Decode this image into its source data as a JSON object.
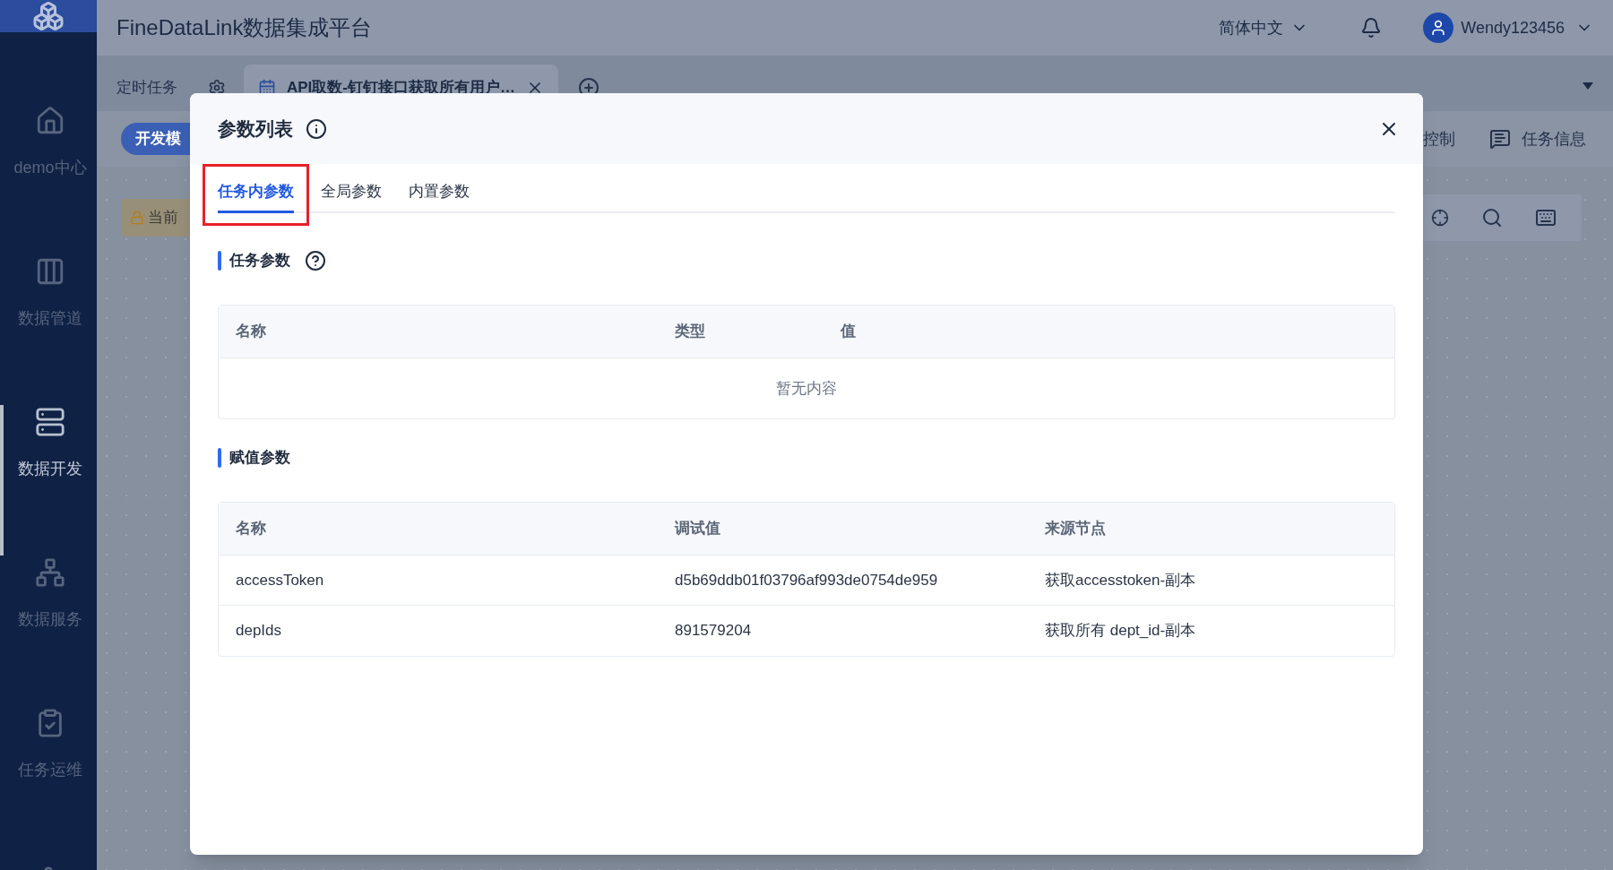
{
  "app": {
    "title": "FineDataLink数据集成平台",
    "language": "简体中文",
    "user": "Wendy123456"
  },
  "sidebar": {
    "items": [
      {
        "label": "demo中心",
        "selected": false
      },
      {
        "label": "数据管道",
        "selected": false
      },
      {
        "label": "数据开发",
        "selected": true
      },
      {
        "label": "数据服务",
        "selected": false
      },
      {
        "label": "任务运维",
        "selected": false
      }
    ]
  },
  "task_folder": {
    "label": "定时任务"
  },
  "open_tabs": [
    {
      "label": "API取数-钉钉接口获取所有用户…",
      "selected": true
    }
  ],
  "toolbar": {
    "mode_button": "开发模",
    "notice": "当前",
    "items": [
      "控制",
      "任务信息"
    ]
  },
  "dialog": {
    "title": "参数列表",
    "tabs": [
      {
        "label": "任务内参数",
        "selected": true,
        "highlighted": true
      },
      {
        "label": "全局参数",
        "selected": false,
        "highlighted": false
      },
      {
        "label": "内置参数",
        "selected": false,
        "highlighted": false
      }
    ],
    "sections": [
      {
        "title": "任务参数",
        "help": true,
        "columns": [
          "名称",
          "类型",
          "值"
        ],
        "empty_text": "暂无内容"
      },
      {
        "title": "赋值参数",
        "columns": [
          "名称",
          "调试值",
          "来源节点"
        ],
        "rows": [
          [
            "accessToken",
            "d5b69ddb01f03796af993de0754de959",
            "获取accesstoken-副本"
          ],
          [
            "depIds",
            "891579204",
            "获取所有 dept_id-副本"
          ]
        ]
      }
    ]
  }
}
